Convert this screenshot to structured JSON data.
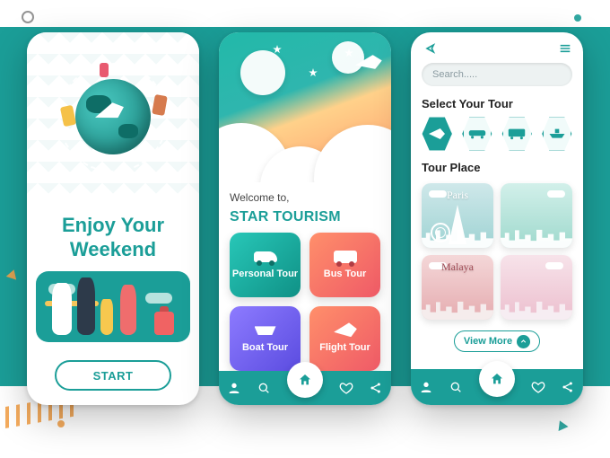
{
  "accent": "#1b9e98",
  "screen1": {
    "title_line1": "Enjoy Your",
    "title_line2": "Weekend",
    "start_label": "START"
  },
  "screen2": {
    "welcome": "Welcome to,",
    "brand": "STAR TOURISM",
    "cards": [
      {
        "label": "Personal Tour",
        "icon": "car-icon"
      },
      {
        "label": "Bus Tour",
        "icon": "bus-icon"
      },
      {
        "label": "Boat Tour",
        "icon": "boat-icon"
      },
      {
        "label": "Flight Tour",
        "icon": "plane-icon"
      }
    ],
    "nav_icons": [
      "user-icon",
      "search-icon",
      "home-icon",
      "heart-icon",
      "share-icon"
    ]
  },
  "screen3": {
    "back_icon": "back-icon",
    "menu_icon": "menu-icon",
    "search_placeholder": "Search.....",
    "select_heading": "Select Your Tour",
    "transport": [
      {
        "icon": "plane-icon",
        "active": true
      },
      {
        "icon": "car-icon",
        "active": false
      },
      {
        "icon": "bus-icon",
        "active": false
      },
      {
        "icon": "ship-icon",
        "active": false
      }
    ],
    "place_heading": "Tour Place",
    "places": [
      {
        "label": "Paris"
      },
      {
        "label": ""
      },
      {
        "label": "Malaya"
      },
      {
        "label": ""
      }
    ],
    "view_more": "View More",
    "nav_icons": [
      "user-icon",
      "search-icon",
      "home-icon",
      "heart-icon",
      "share-icon"
    ]
  }
}
